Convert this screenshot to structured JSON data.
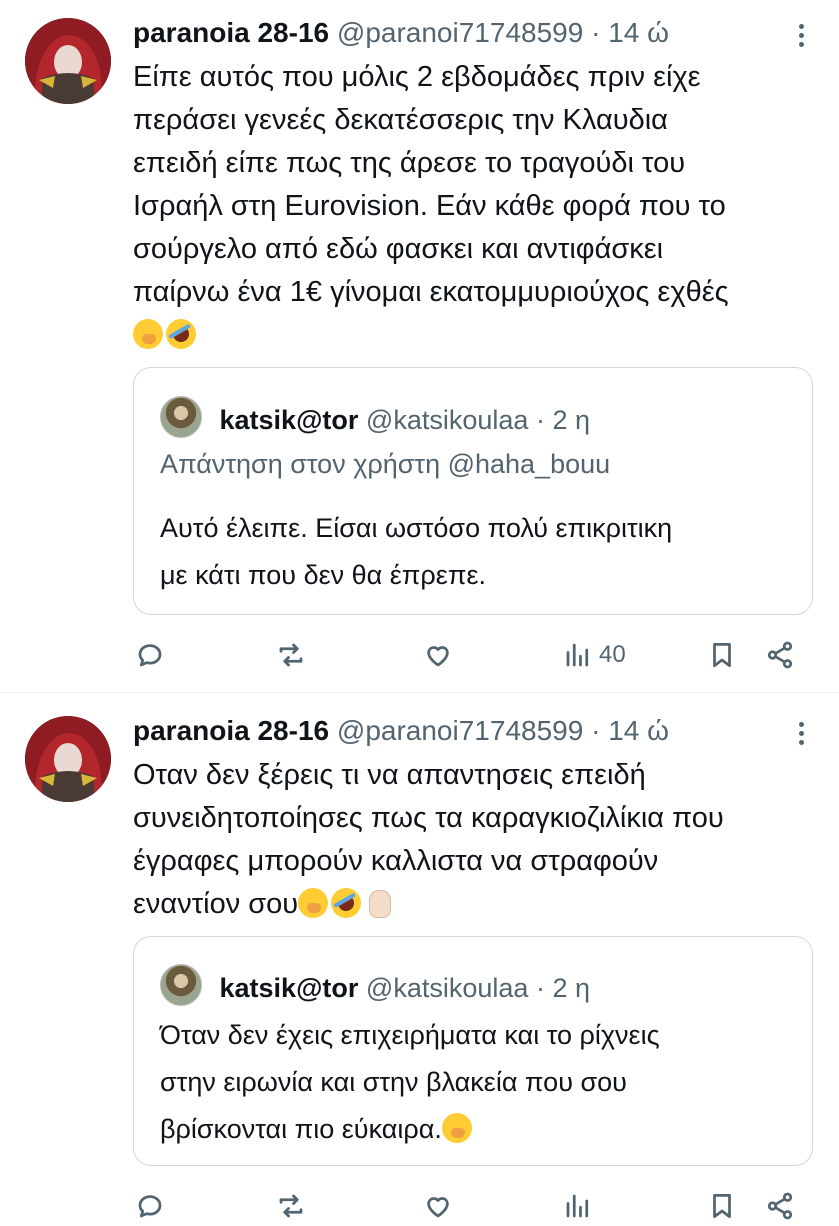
{
  "tweets": [
    {
      "name": "paranoia 28-16",
      "handle": "@paranoi71748599",
      "dot": "·",
      "time": "14 ώ",
      "text_lines": [
        "Είπε αυτός που μόλις 2 εβδομάδες πριν είχε",
        "περάσει γενεές δεκατέσσερις την Κλαυδια",
        "επειδή είπε πως της άρεσε το τραγούδι του",
        "Ισραήλ στη Eurovision. Εάν κάθε φορά που το",
        "σούργελο από εδώ φασκει και αντιφάσκει",
        "παίρνω ένα 1€ γίνομαι εκατομμυριούχος εχθές"
      ],
      "emojis": [
        "hand-over-mouth-emoji",
        "rolling-laughing-emoji"
      ],
      "quote": {
        "name": "katsik@tor",
        "handle": "@katsikoulaa",
        "dot": "·",
        "time": "2 η",
        "replying_to": "Απάντηση στον χρήστη @haha_bouu",
        "text_lines": [
          "Αυτό έλειπε. Είσαι ωστόσο πολύ επικριτικη",
          "με κάτι που δεν θα έπρεπε."
        ]
      },
      "actions": {
        "reply_count": "",
        "retweet_count": "",
        "like_count": "",
        "views_count": "40"
      }
    },
    {
      "name": "paranoia 28-16",
      "handle": "@paranoi71748599",
      "dot": "·",
      "time": "14 ώ",
      "text_lines": [
        "Οταν δεν ξέρεις τι να απαντησεις επειδή",
        "συνειδητοποίησες πως τα καραγκιοζιλίκια που",
        "έγραφες μπορούν καλλιστα να στραφούν",
        "εναντίον σου"
      ],
      "emojis": [
        "hand-over-mouth-emoji",
        "rolling-laughing-emoji",
        "raised-hand-emoji"
      ],
      "quote": {
        "name": "katsik@tor",
        "handle": "@katsikoulaa",
        "dot": "·",
        "time": "2 η",
        "text_lines": [
          "Όταν δεν έχεις επιχειρήματα και το ρίχνεις",
          "στην ειρωνία και στην βλακεία που σου",
          "βρίσκονται πιο εύκαιρα."
        ]
      }
    }
  ],
  "colors": {
    "text": "#0f1419",
    "secondary": "#536471",
    "border": "#cfd9de",
    "divider": "#eff3f4"
  }
}
